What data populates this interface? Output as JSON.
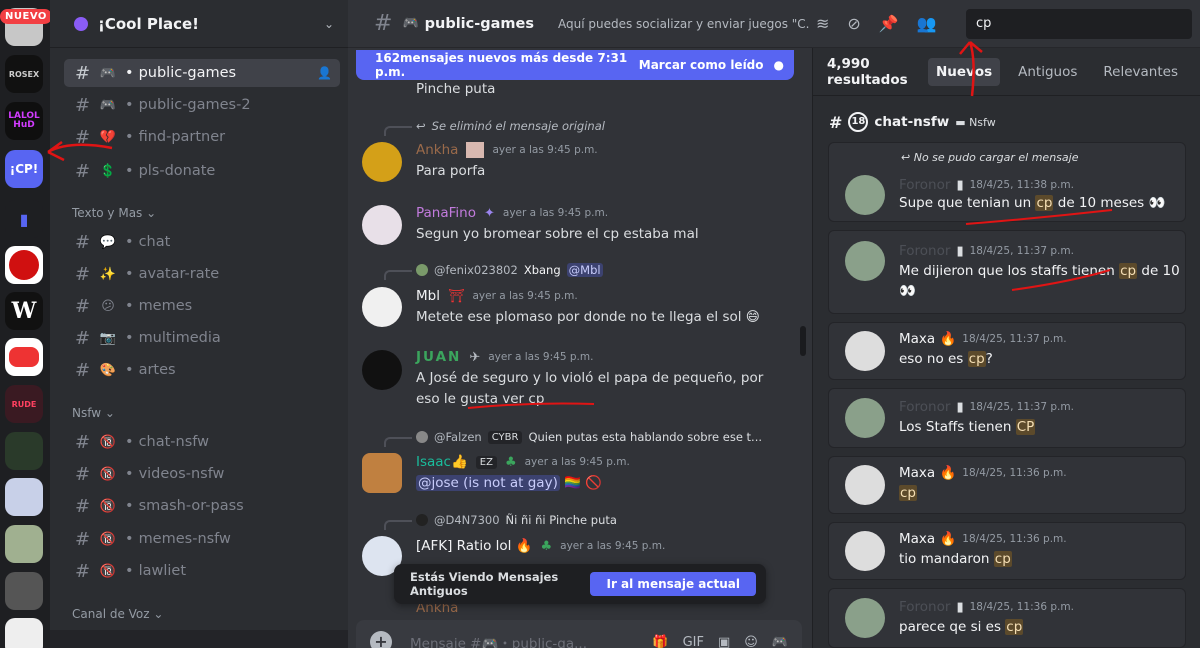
{
  "rail": {
    "new_badge": "NUEVO",
    "servers": [
      {
        "name": "server-1",
        "color": "#c7c7c7",
        "label": ""
      },
      {
        "name": "server-rosex",
        "color": "#111111",
        "label": "ROSEX"
      },
      {
        "name": "server-lalol",
        "color": "#0f0f0f",
        "label": "LALOL HuD"
      },
      {
        "name": "server-cool-place",
        "color": "#5865f2",
        "label": "¡CP!"
      },
      {
        "name": "server-folder",
        "color": "#1e1f22",
        "label": ""
      },
      {
        "name": "server-red",
        "color": "#cc1010",
        "label": ""
      },
      {
        "name": "server-w",
        "color": "#111111",
        "label": "W"
      },
      {
        "name": "server-face",
        "color": "#e33",
        "label": ""
      },
      {
        "name": "server-red-text",
        "color": "#3a1a22",
        "label": ""
      },
      {
        "name": "server-green",
        "color": "#2a3a2a",
        "label": ""
      },
      {
        "name": "server-anime",
        "color": "#c8d0e8",
        "label": ""
      },
      {
        "name": "server-smile",
        "color": "#a0b090",
        "label": ""
      },
      {
        "name": "server-gray",
        "color": "#555555",
        "label": ""
      }
    ]
  },
  "sidebar": {
    "guild_name": "¡Cool Place!",
    "channels": [
      {
        "emoji": "🎮",
        "name": "public-games",
        "active": true
      },
      {
        "emoji": "🎮",
        "name": "public-games-2",
        "active": false
      },
      {
        "emoji": "💔",
        "name": "find-partner",
        "active": false
      },
      {
        "emoji": "💲",
        "name": "pls-donate",
        "active": false
      }
    ],
    "categories": {
      "texto": "Texto y Mas",
      "nsfw": "Nsfw",
      "voz": "Canal de Voz"
    },
    "texto_channels": [
      {
        "emoji": "💬",
        "name": "chat"
      },
      {
        "emoji": "✨",
        "name": "avatar-rate"
      },
      {
        "emoji": "😕",
        "name": "memes"
      },
      {
        "emoji": "📷",
        "name": "multimedia"
      },
      {
        "emoji": "🎨",
        "name": "artes"
      }
    ],
    "nsfw_channels": [
      {
        "emoji": "🔞",
        "name": "chat-nsfw"
      },
      {
        "emoji": "🔞",
        "name": "videos-nsfw"
      },
      {
        "emoji": "🔞",
        "name": "smash-or-pass"
      },
      {
        "emoji": "🔞",
        "name": "memes-nsfw"
      },
      {
        "emoji": "🔞",
        "name": "lawliet"
      }
    ]
  },
  "topbar": {
    "channel_emoji": "🎮",
    "channel_name": "public-games",
    "topic": "Aquí puedes socializar y enviar juegos \"C...",
    "icons": [
      "threads-icon",
      "mute-icon",
      "pin-icon",
      "members-icon"
    ]
  },
  "search": {
    "query": "cp"
  },
  "banner": {
    "text": "162mensajes nuevos más desde 7:31 p.m.",
    "action": "Marcar como leído"
  },
  "messages": {
    "m0_text": "Pinche puta",
    "m1_reply": "Se eliminó el mensaje original",
    "m1_user": "Ankha",
    "m1_ts": "ayer a las 9:45 p.m.",
    "m1_text": "Para porfa",
    "m2_user": "PanaFino",
    "m2_ts": "ayer a las 9:45 p.m.",
    "m2_text": "Segun yo bromear sobre el cp estaba mal",
    "m3_reply_user": "@fenix023802",
    "m3_reply_tag": "Xbang",
    "m3_reply_mention": "@Mbl",
    "m3_user": "Mbl",
    "m3_ts": "ayer a las 9:45 p.m.",
    "m3_text": "Metete ese plomaso por donde no te llega el sol 😄",
    "m4_user": "JUAN",
    "m4_ts": "ayer a las 9:45 p.m.",
    "m4_text1": "A José de seguro y lo violó el papa de pequeño, por",
    "m4_text2": "eso le gusta ver cp",
    "m5_reply_user": "@Falzen",
    "m5_reply_tag": "CYBR",
    "m5_reply_text": "Quien putas esta hablando sobre ese t...",
    "m5_user": "Isaac👍",
    "m5_badge": "EZ",
    "m5_ts": "ayer a las 9:45 p.m.",
    "m5_text": "@jose (is not at gay)",
    "m6_reply_user": "@D4N7300",
    "m6_reply_text": "Ñi ñi ñi Pinche puta",
    "m6_text": "[AFK] Ratio lol 🔥",
    "m6_ts": "ayer a las 9:45 p.m.",
    "m7_user": "Ankha"
  },
  "old_bar": {
    "text": "Estás Viendo Mensajes Antiguos",
    "button": "Ir al mensaje actual"
  },
  "composer": {
    "placeholder": "Mensaje #🎮・public-ga..."
  },
  "results": {
    "count": "4,990 resultados",
    "tabs": [
      "Nuevos",
      "Antiguos",
      "Relevantes"
    ],
    "channel": "chat-nsfw",
    "category": "Nsfw",
    "cards": [
      {
        "reply": "No se pudo cargar el mensaje",
        "user": "Foronor",
        "ts": "18/4/25, 11:38 p.m.",
        "pre": "Supe que tenian un ",
        "hl": "cp",
        "post": " de 10 meses 👀"
      },
      {
        "user": "Foronor",
        "ts": "18/4/25, 11:37 p.m.",
        "pre": "Me dijieron que los staffs tienen ",
        "hl": "cp",
        "post": " de 10",
        "line2": "👀"
      },
      {
        "user": "Maxa 🔥",
        "ts": "18/4/25, 11:37 p.m.",
        "pre": "eso no es ",
        "hl": "cp",
        "post": "?"
      },
      {
        "user": "Foronor",
        "ts": "18/4/25, 11:37 p.m.",
        "pre": "Los Staffs tienen ",
        "hl": "CP",
        "post": ""
      },
      {
        "user": "Maxa 🔥",
        "ts": "18/4/25, 11:36 p.m.",
        "pre": "",
        "hl": "cp",
        "post": ""
      },
      {
        "user": "Maxa 🔥",
        "ts": "18/4/25, 11:36 p.m.",
        "pre": "tio mandaron ",
        "hl": "cp",
        "post": ""
      },
      {
        "user": "Foronor",
        "ts": "18/4/25, 11:36 p.m.",
        "pre": "parece qe si es ",
        "hl": "cp",
        "post": ""
      }
    ]
  }
}
